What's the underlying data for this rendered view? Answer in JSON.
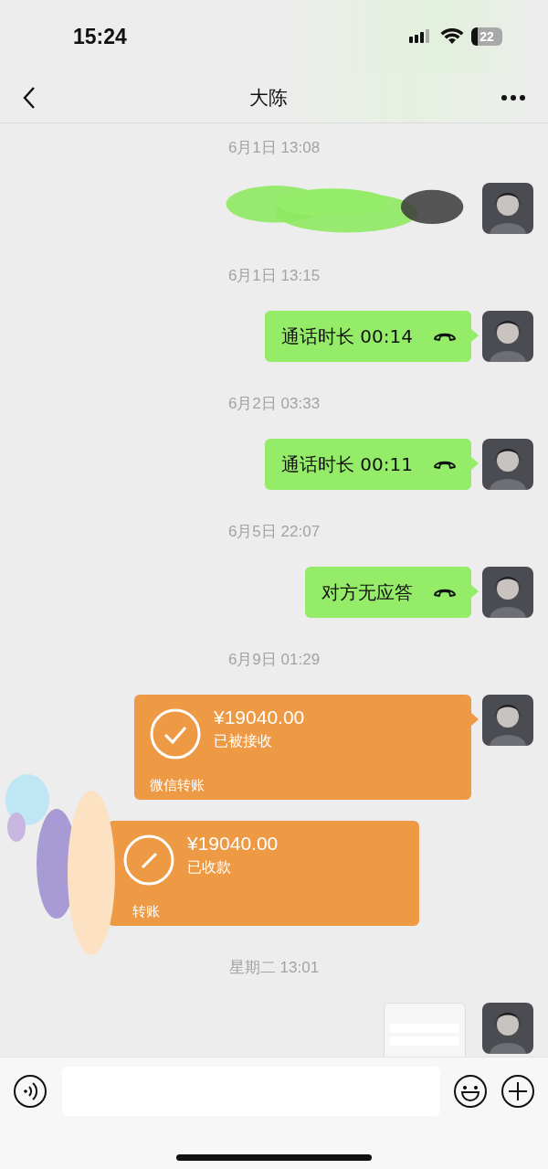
{
  "status_bar": {
    "time": "15:24",
    "battery": "22"
  },
  "nav": {
    "title": "大陈"
  },
  "messages": [
    {
      "kind": "time",
      "text": "6月1日 13:08"
    },
    {
      "kind": "redacted",
      "outgoing": true
    },
    {
      "kind": "time",
      "text": "6月1日 13:15"
    },
    {
      "kind": "call",
      "outgoing": true,
      "text": "通话时长 00:14"
    },
    {
      "kind": "time",
      "text": "6月2日 03:33"
    },
    {
      "kind": "call",
      "outgoing": true,
      "text": "通话时长 00:11"
    },
    {
      "kind": "time",
      "text": "6月5日 22:07"
    },
    {
      "kind": "call",
      "outgoing": true,
      "text": "对方无应答"
    },
    {
      "kind": "time",
      "text": "6月9日 01:29"
    },
    {
      "kind": "transfer",
      "outgoing": true,
      "amount": "¥19040.00",
      "status": "已被接收",
      "label": "微信转账"
    },
    {
      "kind": "transfer",
      "outgoing": false,
      "amount": "¥19040.00",
      "status": "已收款",
      "label": "转账"
    },
    {
      "kind": "time",
      "text": "星期二 13:01"
    },
    {
      "kind": "image",
      "outgoing": true
    }
  ]
}
